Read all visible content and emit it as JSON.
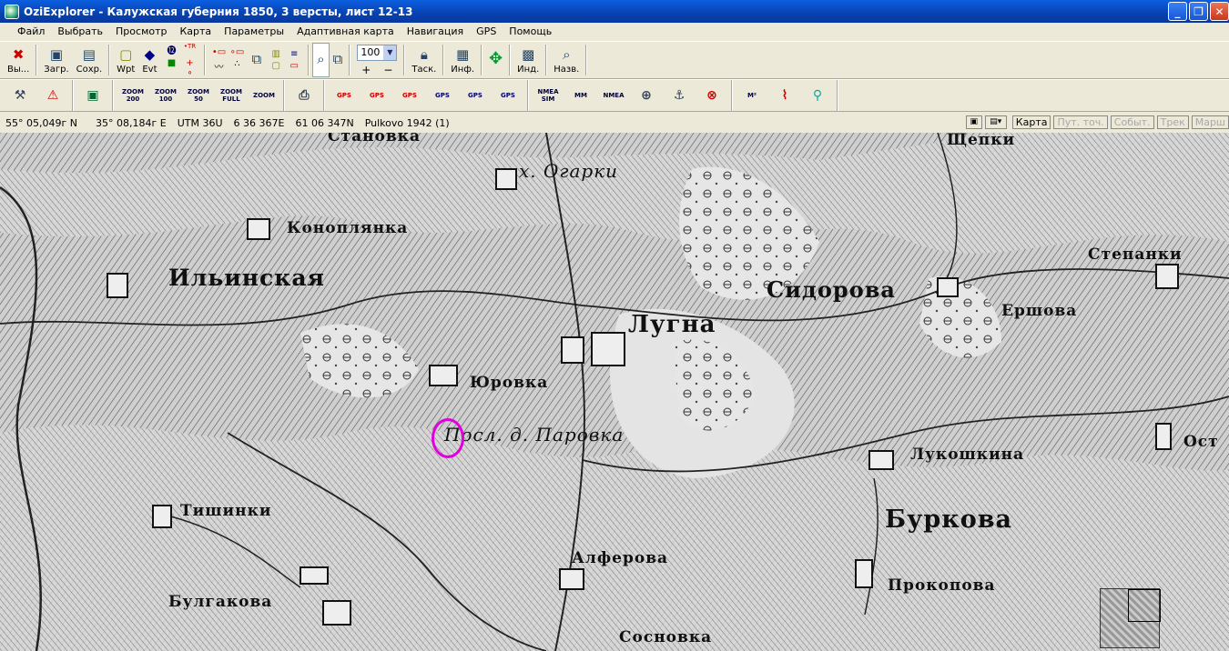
{
  "window": {
    "title": "OziExplorer - Калужская губерния 1850, 3 версты, лист 12-13",
    "minimize": "_",
    "maximize": "❐",
    "close": "✕"
  },
  "menu": [
    "Файл",
    "Выбрать",
    "Просмотр",
    "Карта",
    "Параметры",
    "Адаптивная карта",
    "Навигация",
    "GPS",
    "Помощь"
  ],
  "toolbar1": {
    "exit": "Вы...",
    "load": "Загр.",
    "save": "Сохр.",
    "wpt": "Wpt",
    "evt": "Evt",
    "zoom_value": "100",
    "zoom_in": "+",
    "zoom_out": "−",
    "task": "Таск.",
    "info": "Инф.",
    "ind": "Инд.",
    "name": "Назв."
  },
  "toolbar2": {
    "zoom200": "ZOOM 200",
    "zoom100": "ZOOM 100",
    "zoom50": "ZOOM 50",
    "zoomfull": "ZOOM FULL",
    "zoom_sel": "ZOOM",
    "gps1": "GPS",
    "gps2": "GPS",
    "gps3": "GPS",
    "gps4": "GPS",
    "gps5": "GPS",
    "gps6": "GPS",
    "nmea_sim": "NMEA SIM",
    "mm": "MM",
    "nmea": "NMEA"
  },
  "status": {
    "lat": "55° 05,049г N",
    "lon": "35° 08,184г E",
    "utm": "UTM  36U",
    "easting": "6 36 367E",
    "northing": "61 06 347N",
    "datum": "Pulkovo 1942 (1)",
    "tabs": [
      "Карта",
      "Пут. точ.",
      "Событ.",
      "Трек",
      "Марш"
    ]
  },
  "map": {
    "labels": {
      "stanovka": "Становка",
      "ogarki": "х. Огарки",
      "shchepki": "Щепки",
      "konoplyanka": "Коноплянка",
      "ilinskaya": "Ильинская",
      "sidorova": "Сидорова",
      "lugna": "Лугна",
      "stepantsi": "Степанки",
      "ershova": "Ершова",
      "yurovka": "Юровка",
      "parovka": "Посл. д. Паровка",
      "lukoshkina": "Лукошкина",
      "ost": "Ост",
      "tishinki": "Тишинки",
      "burkova": "Буркова",
      "alferova": "Алферова",
      "prokopova": "Прокопова",
      "bulgakova": "Булгакова",
      "sosnovka": "Сосновка"
    }
  },
  "colors": {
    "marker": "#e000e0",
    "titlebar": "#0a5fe0"
  }
}
